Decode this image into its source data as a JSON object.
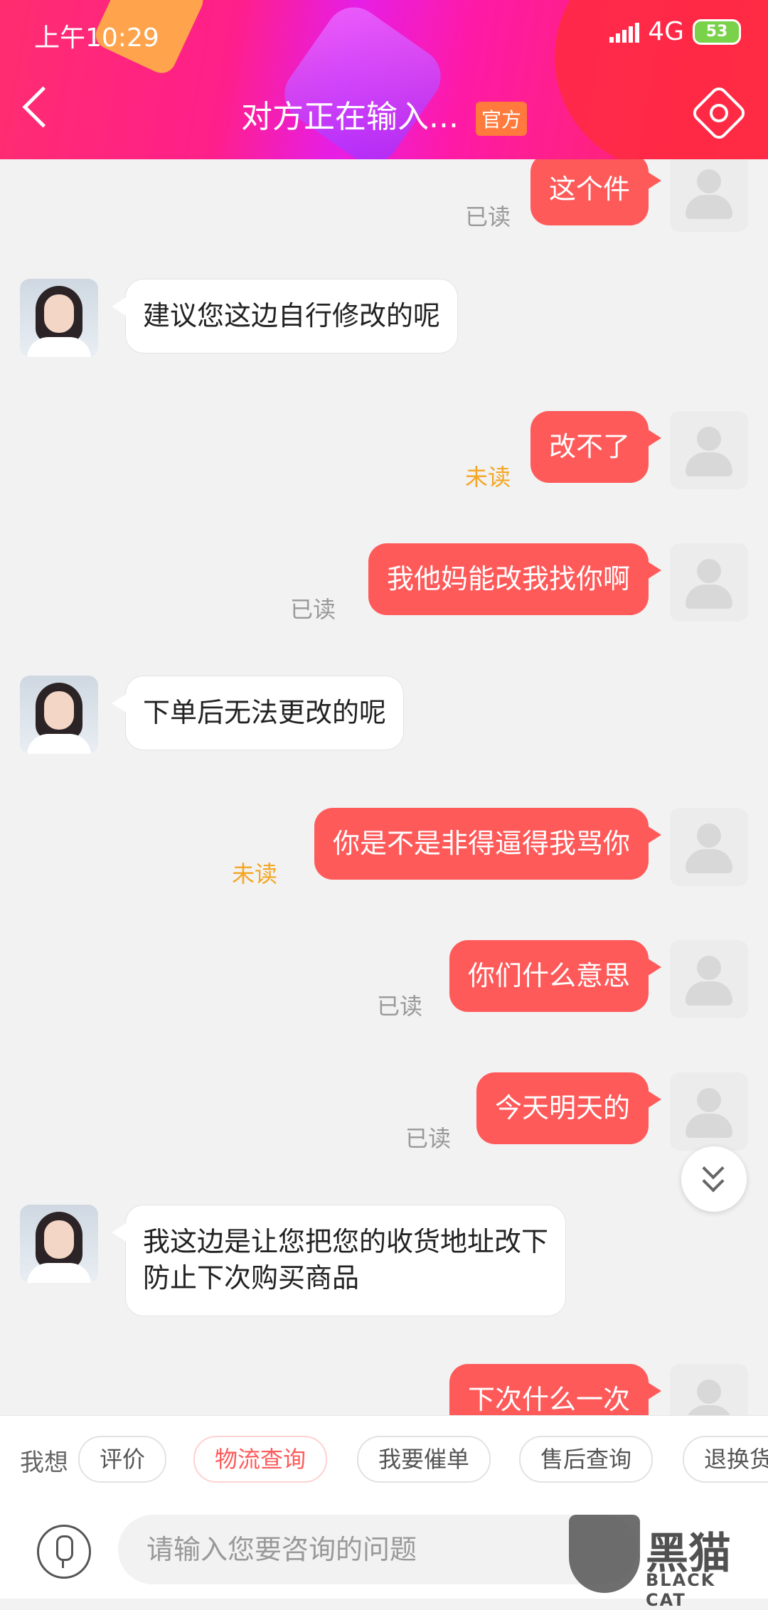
{
  "status_bar": {
    "time": "上午10:29",
    "network": "4G",
    "battery": "53"
  },
  "nav": {
    "title": "对方正在输入...",
    "badge": "官方"
  },
  "messages": [
    {
      "side": "out",
      "text": "这个件",
      "status": "已读"
    },
    {
      "side": "in",
      "text": "建议您这边自行修改的呢"
    },
    {
      "side": "out",
      "text": "改不了",
      "status": "未读"
    },
    {
      "side": "out",
      "text": "我他妈能改我找你啊",
      "status": "已读"
    },
    {
      "side": "in",
      "text": "下单后无法更改的呢"
    },
    {
      "side": "out",
      "text": "你是不是非得逼得我骂你",
      "status": "未读"
    },
    {
      "side": "out",
      "text": "你们什么意思",
      "status": "已读"
    },
    {
      "side": "out",
      "text": "今天明天的",
      "status": "已读"
    },
    {
      "side": "in",
      "text": "我这边是让您把您的收货地址改下\n防止下次购买商品"
    },
    {
      "side": "out",
      "text": "下次什么一次",
      "status": ""
    }
  ],
  "quick_bar": {
    "label": "我想",
    "chips": [
      "评价",
      "物流查询",
      "我要催单",
      "售后查询",
      "退换货"
    ]
  },
  "input": {
    "placeholder": "请输入您要咨询的问题"
  },
  "watermark": {
    "text": "黑猫",
    "sub": "BLACK CAT"
  }
}
